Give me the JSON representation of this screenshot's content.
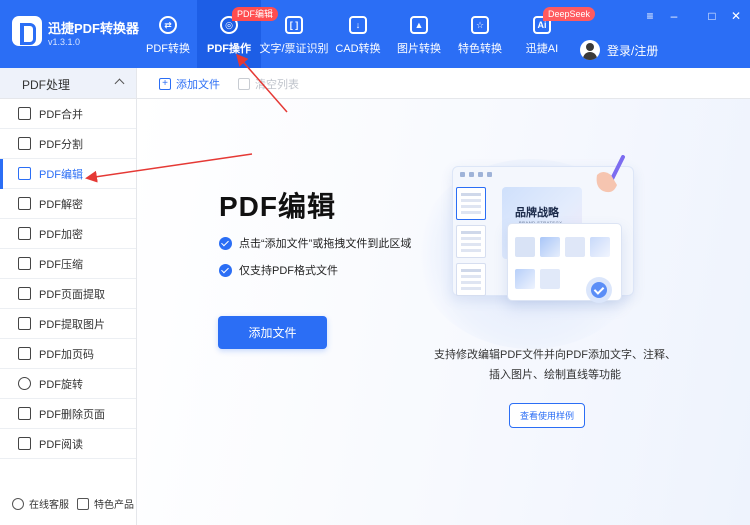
{
  "app": {
    "name": "迅捷PDF转换器",
    "version": "v1.3.1.0"
  },
  "nav": [
    {
      "label": "PDF转换",
      "icon": "convert-icon"
    },
    {
      "label": "PDF操作",
      "icon": "pdf-operate-icon",
      "badge": "PDF编辑",
      "active": true
    },
    {
      "label": "文字/票证识别",
      "icon": "ocr-icon"
    },
    {
      "label": "CAD转换",
      "icon": "cad-icon"
    },
    {
      "label": "图片转换",
      "icon": "image-icon"
    },
    {
      "label": "特色转换",
      "icon": "star-icon"
    },
    {
      "label": "迅捷AI",
      "icon": "ai-icon",
      "icon_text": "Ai",
      "badge": "DeepSeek"
    }
  ],
  "user": {
    "label": "登录/注册"
  },
  "window_controls": {
    "menu": "≡",
    "minimize": "–",
    "maximize": "□",
    "close": "✕"
  },
  "sidebar": {
    "section": "PDF处理",
    "items": [
      {
        "label": "PDF合并",
        "icon": "merge-icon"
      },
      {
        "label": "PDF分割",
        "icon": "split-icon"
      },
      {
        "label": "PDF编辑",
        "icon": "edit-icon",
        "active": true
      },
      {
        "label": "PDF解密",
        "icon": "unlock-icon"
      },
      {
        "label": "PDF加密",
        "icon": "shield-icon"
      },
      {
        "label": "PDF压缩",
        "icon": "compress-icon"
      },
      {
        "label": "PDF页面提取",
        "icon": "page-extract-icon"
      },
      {
        "label": "PDF提取图片",
        "icon": "image-extract-icon"
      },
      {
        "label": "PDF加页码",
        "icon": "page-number-icon"
      },
      {
        "label": "PDF旋转",
        "icon": "rotate-icon"
      },
      {
        "label": "PDF删除页面",
        "icon": "delete-page-icon"
      },
      {
        "label": "PDF阅读",
        "icon": "book-icon"
      }
    ],
    "footer": [
      {
        "label": "在线客服",
        "icon": "headset-icon"
      },
      {
        "label": "特色产品",
        "icon": "products-icon"
      }
    ]
  },
  "toolbar": {
    "add_file": "添加文件",
    "clear_list": "清空列表"
  },
  "main": {
    "title": "PDF编辑",
    "checks": [
      "点击“添加文件”或拖拽文件到此区域",
      "仅支持PDF格式文件"
    ],
    "add_button": "添加文件",
    "desc_line1": "支持修改编辑PDF文件并向PDF添加文字、注释、",
    "desc_line2": "插入图片、绘制直线等功能",
    "example_button": "查看使用样例",
    "illustration": {
      "poster_title": "品牌战略",
      "poster_subtitle": "BRAND STRATEGY"
    }
  },
  "colors": {
    "accent": "#2b6ef5",
    "topbar": "#2b6ef5",
    "badge": "#ff4d4f",
    "annotation": "#e53935"
  }
}
